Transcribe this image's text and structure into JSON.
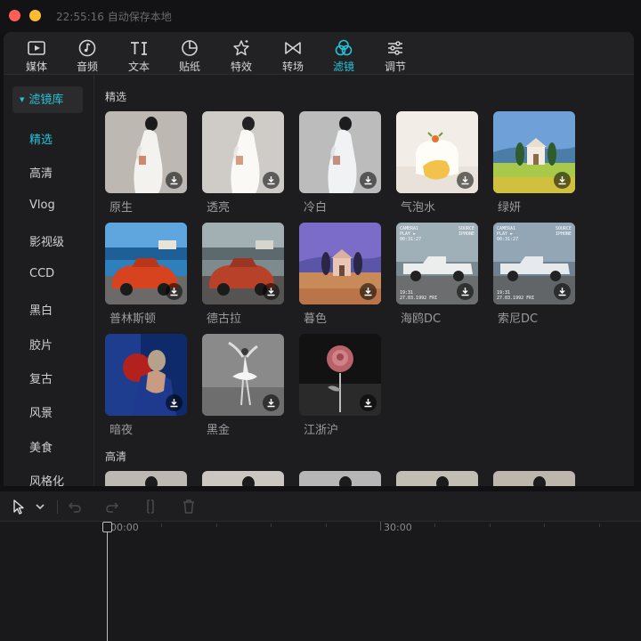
{
  "titlebar": {
    "status": "22:55:16 自动保存本地"
  },
  "toolbar": {
    "tabs": [
      {
        "label": "媒体",
        "icon": "play-media-icon",
        "active": false
      },
      {
        "label": "音频",
        "icon": "music-note-icon",
        "active": false
      },
      {
        "label": "文本",
        "icon": "text-TI-icon",
        "active": false
      },
      {
        "label": "贴纸",
        "icon": "sticker-icon",
        "active": false
      },
      {
        "label": "特效",
        "icon": "star-effect-icon",
        "active": false
      },
      {
        "label": "转场",
        "icon": "transition-bowtie-icon",
        "active": false
      },
      {
        "label": "滤镜",
        "icon": "filter-circles-icon",
        "active": true
      },
      {
        "label": "调节",
        "icon": "sliders-icon",
        "active": false
      }
    ]
  },
  "sidebar": {
    "header": "滤镜库",
    "items": [
      "精选",
      "高清",
      "Vlog",
      "影视级",
      "CCD",
      "黑白",
      "胶片",
      "复古",
      "风景",
      "美食",
      "风格化"
    ],
    "active_index": 0
  },
  "sections": [
    {
      "title": "精选",
      "filters": [
        "原生",
        "透亮",
        "冷白",
        "气泡水",
        "绿妍",
        "普林斯顿",
        "德古拉",
        "暮色",
        "海鸥DC",
        "索尼DC",
        "暗夜",
        "黑金",
        "江浙沪"
      ]
    },
    {
      "title": "高清"
    }
  ],
  "thumb_text": {
    "camera": "CAMERA1",
    "play": "PLAY ►",
    "timecode": "00:31:27",
    "source": "SOURCE",
    "device": "IPHONE",
    "time": "19:31",
    "date": "27.03.1992 FRI"
  },
  "timeline": {
    "ruler_labels": [
      "00:00",
      "30:00"
    ],
    "tools": [
      "select-cursor-icon",
      "chevron-down-icon",
      "undo-icon",
      "redo-icon",
      "split-icon",
      "trash-icon"
    ]
  },
  "colors": {
    "accent": "#27c2d6",
    "background": "#111113",
    "panel": "#1d1d1f"
  }
}
